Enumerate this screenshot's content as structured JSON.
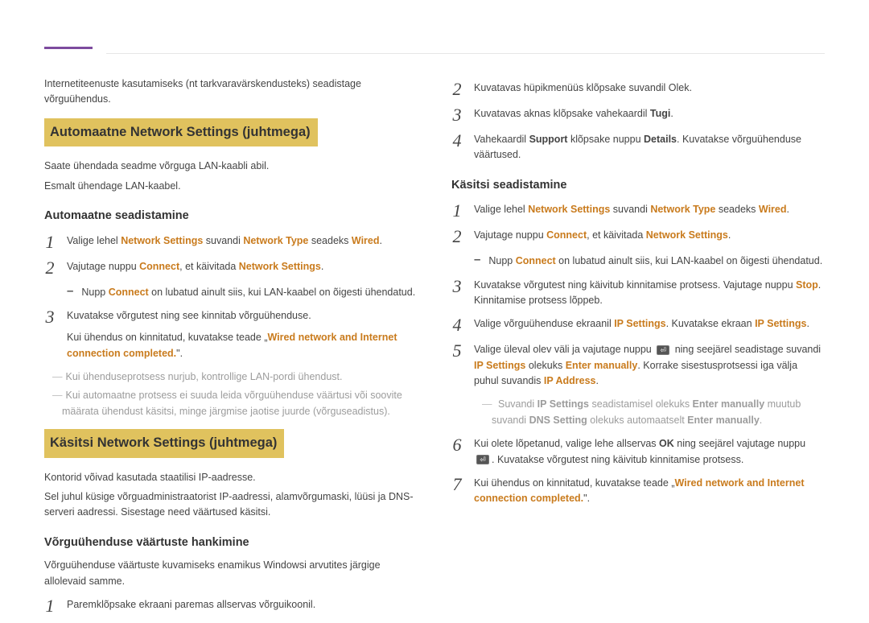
{
  "intro": "Internetiteenuste kasutamiseks (nt tarkvaravärskendusteks) seadistage võrguühendus.",
  "left": {
    "section1_title": "Automaatne Network Settings (juhtmega)",
    "s1_para1": "Saate ühendada seadme võrguga LAN-kaabli abil.",
    "s1_para2": "Esmalt ühendage LAN-kaabel.",
    "sub1": "Automaatne seadistamine",
    "s1_step1_a": "Valige lehel ",
    "s1_step1_b": "Network Settings",
    "s1_step1_c": " suvandi ",
    "s1_step1_d": "Network Type",
    "s1_step1_e": " seadeks ",
    "s1_step1_f": "Wired",
    "s1_step1_g": ".",
    "s1_step2_a": "Vajutage nuppu ",
    "s1_step2_b": "Connect",
    "s1_step2_c": ", et käivitada ",
    "s1_step2_d": "Network Settings",
    "s1_step2_e": ".",
    "s1_step2_sub_a": "Nupp ",
    "s1_step2_sub_b": "Connect",
    "s1_step2_sub_c": " on lubatud ainult siis, kui LAN-kaabel on õigesti ühendatud.",
    "s1_step3_a": "Kuvatakse võrgutest ning see kinnitab võrguühenduse.",
    "s1_step3_b1": "Kui ühendus on kinnitatud, kuvatakse teade „",
    "s1_step3_b2": "Wired network and Internet connection completed.",
    "s1_step3_b3": "\".",
    "s1_gray1": "Kui ühenduseprotsess nurjub, kontrollige LAN-pordi ühendust.",
    "s1_gray2": "Kui automaatne protsess ei suuda leida võrguühenduse väärtusi või soovite määrata ühendust käsitsi, minge järgmise jaotise juurde (võrguseadistus).",
    "section2_title": "Käsitsi Network Settings (juhtmega)",
    "s2_para1": "Kontorid võivad kasutada staatilisi IP-aadresse.",
    "s2_para2": "Sel juhul küsige võrguadministraatorist IP-aadressi, alamvõrgumaski, lüüsi ja DNS-serveri aadressi. Sisestage need väärtused käsitsi.",
    "sub2": "Võrguühenduse väärtuste hankimine",
    "s2_para3": "Võrguühenduse väärtuste kuvamiseks enamikus Windowsi arvutites järgige allolevaid samme.",
    "s2_step1": "Paremklõpsake ekraani paremas allservas võrguikoonil."
  },
  "right": {
    "step2": "Kuvatavas hüpikmenüüs klõpsake suvandil Olek.",
    "step3_a": "Kuvatavas aknas klõpsake vahekaardil ",
    "step3_b": "Tugi",
    "step3_c": ".",
    "step4_a": "Vahekaardil ",
    "step4_b": "Support",
    "step4_c": " klõpsake nuppu ",
    "step4_d": "Details",
    "step4_e": ". Kuvatakse võrguühenduse väärtused.",
    "sub": "Käsitsi seadistamine",
    "k_step1_a": "Valige lehel ",
    "k_step1_b": "Network Settings",
    "k_step1_c": " suvandi ",
    "k_step1_d": "Network Type",
    "k_step1_e": " seadeks ",
    "k_step1_f": "Wired",
    "k_step1_g": ".",
    "k_step2_a": "Vajutage nuppu ",
    "k_step2_b": "Connect",
    "k_step2_c": ", et käivitada ",
    "k_step2_d": "Network Settings",
    "k_step2_e": ".",
    "k_step2_sub_a": "Nupp ",
    "k_step2_sub_b": "Connect",
    "k_step2_sub_c": " on lubatud ainult siis, kui LAN-kaabel on õigesti ühendatud.",
    "k_step3_a": "Kuvatakse võrgutest ning käivitub kinnitamise protsess. Vajutage nuppu ",
    "k_step3_b": "Stop",
    "k_step3_c": ". Kinnitamise protsess lõppeb.",
    "k_step4_a": "Valige võrguühenduse ekraanil ",
    "k_step4_b": "IP Settings",
    "k_step4_c": ". Kuvatakse ekraan ",
    "k_step4_d": "IP Settings",
    "k_step4_e": ".",
    "k_step5_a": "Valige üleval olev väli ja vajutage nuppu ",
    "k_step5_b": " ning seejärel seadistage suvandi ",
    "k_step5_c": "IP Settings",
    "k_step5_d": " olekuks ",
    "k_step5_e": "Enter manually",
    "k_step5_f": ". Korrake sisestusprotsessi iga välja puhul suvandis ",
    "k_step5_g": "IP Address",
    "k_step5_h": ".",
    "k_step5_gray_a": "Suvandi ",
    "k_step5_gray_b": "IP Settings",
    "k_step5_gray_c": " seadistamisel olekuks ",
    "k_step5_gray_d": "Enter manually",
    "k_step5_gray_e": " muutub suvandi ",
    "k_step5_gray_f": "DNS Setting",
    "k_step5_gray_g": " olekuks automaatselt ",
    "k_step5_gray_h": "Enter manually",
    "k_step5_gray_i": ".",
    "k_step6_a": "Kui olete lõpetanud, valige lehe allservas ",
    "k_step6_b": "OK",
    "k_step6_c": " ning seejärel vajutage nuppu ",
    "k_step6_d": ". Kuvatakse võrgutest ning käivitub kinnitamise protsess.",
    "k_step7_a": "Kui ühendus on kinnitatud, kuvatakse teade „",
    "k_step7_b": "Wired network and Internet connection completed.",
    "k_step7_c": "\"."
  }
}
